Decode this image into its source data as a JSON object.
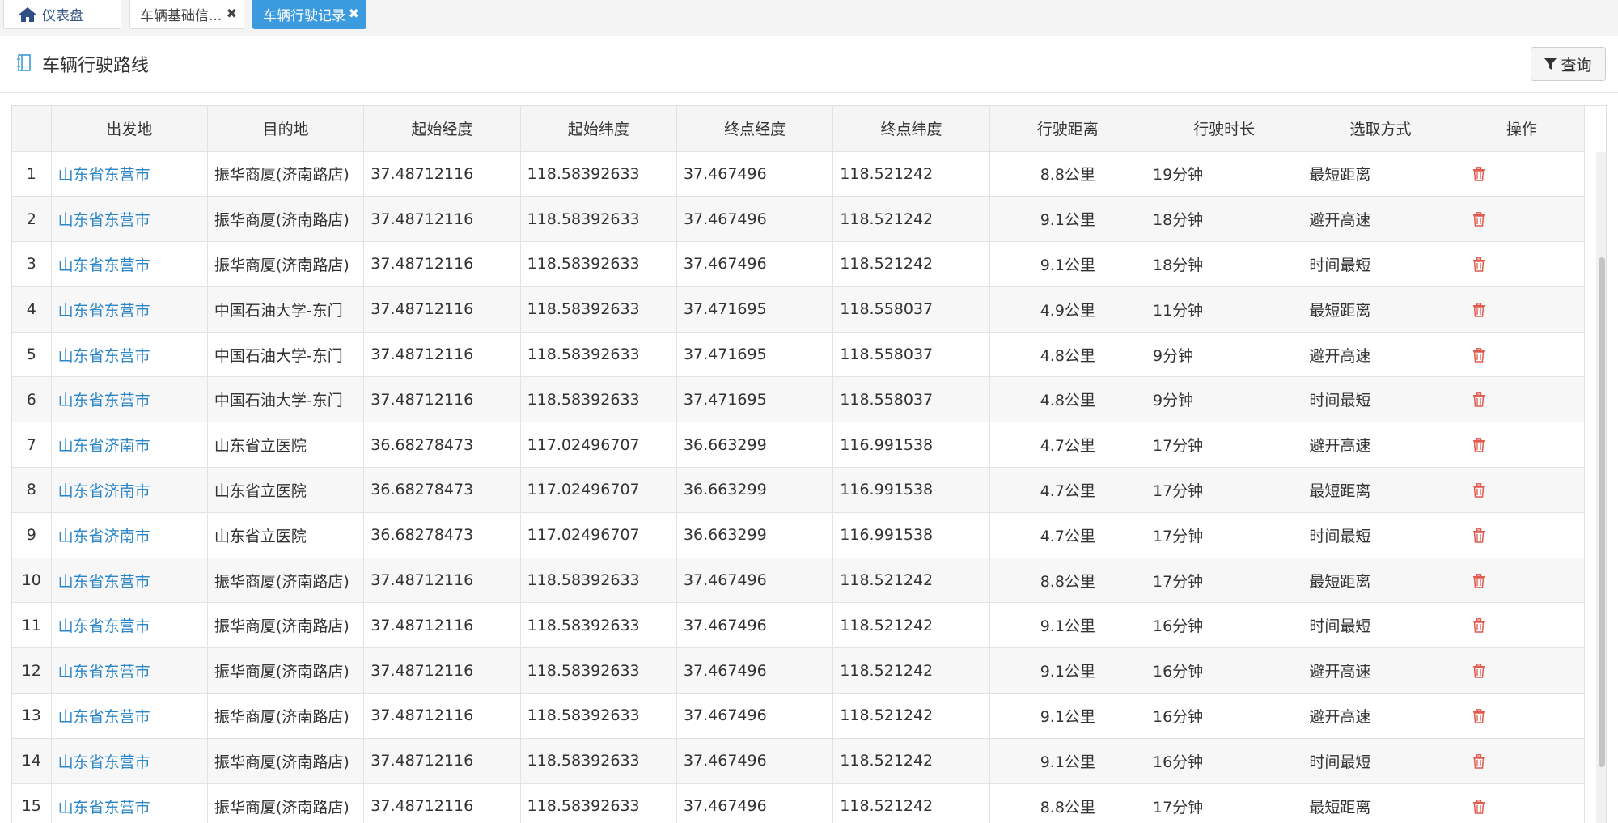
{
  "tabs": [
    {
      "label": "仪表盘",
      "icon": "home-icon"
    },
    {
      "label": "车辆基础信...",
      "icon": "close-icon"
    },
    {
      "label": "车辆行驶记录",
      "icon": "close-icon",
      "active": true
    }
  ],
  "panel": {
    "title": "车辆行驶路线",
    "icon": "book-icon",
    "query_label": "查询"
  },
  "colors": {
    "accent": "#3c9bde",
    "link": "#2a86c9",
    "danger": "#e05a4f"
  },
  "table": {
    "columns": [
      "",
      "出发地",
      "目的地",
      "起始经度",
      "起始纬度",
      "终点经度",
      "终点纬度",
      "行驶距离",
      "行驶时长",
      "选取方式",
      "操作"
    ],
    "rows": [
      [
        "1",
        "山东省东营市",
        "振华商厦(济南路店)",
        "37.48712116",
        "118.58392633",
        "37.467496",
        "118.521242",
        "8.8公里",
        "19分钟",
        "最短距离"
      ],
      [
        "2",
        "山东省东营市",
        "振华商厦(济南路店)",
        "37.48712116",
        "118.58392633",
        "37.467496",
        "118.521242",
        "9.1公里",
        "18分钟",
        "避开高速"
      ],
      [
        "3",
        "山东省东营市",
        "振华商厦(济南路店)",
        "37.48712116",
        "118.58392633",
        "37.467496",
        "118.521242",
        "9.1公里",
        "18分钟",
        "时间最短"
      ],
      [
        "4",
        "山东省东营市",
        "中国石油大学-东门",
        "37.48712116",
        "118.58392633",
        "37.471695",
        "118.558037",
        "4.9公里",
        "11分钟",
        "最短距离"
      ],
      [
        "5",
        "山东省东营市",
        "中国石油大学-东门",
        "37.48712116",
        "118.58392633",
        "37.471695",
        "118.558037",
        "4.8公里",
        "9分钟",
        "避开高速"
      ],
      [
        "6",
        "山东省东营市",
        "中国石油大学-东门",
        "37.48712116",
        "118.58392633",
        "37.471695",
        "118.558037",
        "4.8公里",
        "9分钟",
        "时间最短"
      ],
      [
        "7",
        "山东省济南市",
        "山东省立医院",
        "36.68278473",
        "117.02496707",
        "36.663299",
        "116.991538",
        "4.7公里",
        "17分钟",
        "避开高速"
      ],
      [
        "8",
        "山东省济南市",
        "山东省立医院",
        "36.68278473",
        "117.02496707",
        "36.663299",
        "116.991538",
        "4.7公里",
        "17分钟",
        "最短距离"
      ],
      [
        "9",
        "山东省济南市",
        "山东省立医院",
        "36.68278473",
        "117.02496707",
        "36.663299",
        "116.991538",
        "4.7公里",
        "17分钟",
        "时间最短"
      ],
      [
        "10",
        "山东省东营市",
        "振华商厦(济南路店)",
        "37.48712116",
        "118.58392633",
        "37.467496",
        "118.521242",
        "8.8公里",
        "17分钟",
        "最短距离"
      ],
      [
        "11",
        "山东省东营市",
        "振华商厦(济南路店)",
        "37.48712116",
        "118.58392633",
        "37.467496",
        "118.521242",
        "9.1公里",
        "16分钟",
        "时间最短"
      ],
      [
        "12",
        "山东省东营市",
        "振华商厦(济南路店)",
        "37.48712116",
        "118.58392633",
        "37.467496",
        "118.521242",
        "9.1公里",
        "16分钟",
        "避开高速"
      ],
      [
        "13",
        "山东省东营市",
        "振华商厦(济南路店)",
        "37.48712116",
        "118.58392633",
        "37.467496",
        "118.521242",
        "9.1公里",
        "16分钟",
        "避开高速"
      ],
      [
        "14",
        "山东省东营市",
        "振华商厦(济南路店)",
        "37.48712116",
        "118.58392633",
        "37.467496",
        "118.521242",
        "9.1公里",
        "16分钟",
        "时间最短"
      ],
      [
        "15",
        "山东省东营市",
        "振华商厦(济南路店)",
        "37.48712116",
        "118.58392633",
        "37.467496",
        "118.521242",
        "8.8公里",
        "17分钟",
        "最短距离"
      ]
    ]
  }
}
